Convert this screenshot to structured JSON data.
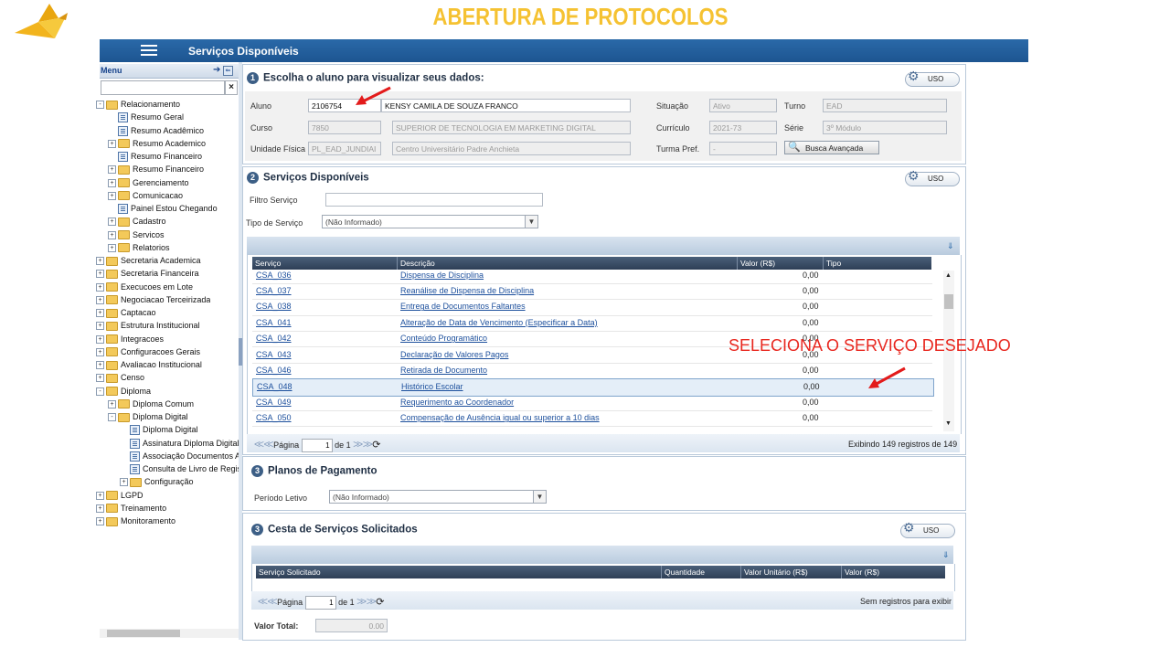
{
  "slide_title": "ABERTURA DE PROTOCOLOS",
  "app": {
    "title": "Serviços Disponíveis"
  },
  "sidebar": {
    "title": "Menu",
    "clear": "×",
    "items": [
      {
        "label": "Relacionamento",
        "level": 0,
        "type": "folder",
        "exp": "-"
      },
      {
        "label": "Resumo Geral",
        "level": 1,
        "type": "doc"
      },
      {
        "label": "Resumo Acadêmico",
        "level": 1,
        "type": "doc"
      },
      {
        "label": "Resumo Academico",
        "level": 1,
        "type": "folder",
        "exp": "+"
      },
      {
        "label": "Resumo Financeiro",
        "level": 1,
        "type": "doc"
      },
      {
        "label": "Resumo Financeiro",
        "level": 1,
        "type": "folder",
        "exp": "+"
      },
      {
        "label": "Gerenciamento",
        "level": 1,
        "type": "folder",
        "exp": "+"
      },
      {
        "label": "Comunicacao",
        "level": 1,
        "type": "folder",
        "exp": "+"
      },
      {
        "label": "Painel Estou Chegando",
        "level": 1,
        "type": "doc"
      },
      {
        "label": "Cadastro",
        "level": 1,
        "type": "folder",
        "exp": "+"
      },
      {
        "label": "Servicos",
        "level": 1,
        "type": "folder",
        "exp": "+"
      },
      {
        "label": "Relatorios",
        "level": 1,
        "type": "folder",
        "exp": "+"
      },
      {
        "label": "Secretaria Academica",
        "level": 0,
        "type": "folder",
        "exp": "+"
      },
      {
        "label": "Secretaria Financeira",
        "level": 0,
        "type": "folder",
        "exp": "+"
      },
      {
        "label": "Execucoes em Lote",
        "level": 0,
        "type": "folder",
        "exp": "+"
      },
      {
        "label": "Negociacao Terceirizada",
        "level": 0,
        "type": "folder",
        "exp": "+"
      },
      {
        "label": "Captacao",
        "level": 0,
        "type": "folder",
        "exp": "+"
      },
      {
        "label": "Estrutura Institucional",
        "level": 0,
        "type": "folder",
        "exp": "+"
      },
      {
        "label": "Integracoes",
        "level": 0,
        "type": "folder",
        "exp": "+"
      },
      {
        "label": "Configuracoes Gerais",
        "level": 0,
        "type": "folder",
        "exp": "+"
      },
      {
        "label": "Avaliacao Institucional",
        "level": 0,
        "type": "folder",
        "exp": "+"
      },
      {
        "label": "Censo",
        "level": 0,
        "type": "folder",
        "exp": "+"
      },
      {
        "label": "Diploma",
        "level": 0,
        "type": "folder",
        "exp": "-"
      },
      {
        "label": "Diploma Comum",
        "level": 1,
        "type": "folder",
        "exp": "+"
      },
      {
        "label": "Diploma Digital",
        "level": 1,
        "type": "folder",
        "exp": "-"
      },
      {
        "label": "Diploma Digital",
        "level": 2,
        "type": "doc"
      },
      {
        "label": "Assinatura Diploma Digital",
        "level": 2,
        "type": "doc"
      },
      {
        "label": "Associação Documentos Al",
        "level": 2,
        "type": "doc"
      },
      {
        "label": "Consulta de Livro de Regist",
        "level": 2,
        "type": "doc"
      },
      {
        "label": "Configuração",
        "level": 2,
        "type": "folder",
        "exp": "+"
      },
      {
        "label": "LGPD",
        "level": 0,
        "type": "folder",
        "exp": "+"
      },
      {
        "label": "Treinamento",
        "level": 0,
        "type": "folder",
        "exp": "+"
      },
      {
        "label": "Monitoramento",
        "level": 0,
        "type": "folder",
        "exp": "+"
      }
    ]
  },
  "section1": {
    "num": "1",
    "title": "Escolha o aluno para visualizar seus dados:",
    "uso": "USO",
    "labels": {
      "aluno": "Aluno",
      "curso": "Curso",
      "unidade": "Unidade Física",
      "situacao": "Situação",
      "curriculo": "Currículo",
      "turma": "Turma Pref.",
      "turno": "Turno",
      "serie": "Série"
    },
    "values": {
      "aluno_code": "2106754",
      "aluno_name": "KENSY CAMILA DE SOUZA FRANCO",
      "curso_code": "7850",
      "curso_name": "SUPERIOR DE TECNOLOGIA EM MARKETING DIGITAL",
      "unidade_code": "PL_EAD_JUNDIAI",
      "unidade_name": "Centro Universitário Padre Anchieta",
      "situacao": "Ativo",
      "curriculo": "2021-73",
      "turma": "-",
      "turno": "EAD",
      "serie": "3º Módulo"
    },
    "busca": "Busca Avançada"
  },
  "section2": {
    "num": "2",
    "title": "Serviços Disponíveis",
    "uso": "USO",
    "filtro_label": "Filtro Serviço",
    "filtro_value": "",
    "tipo_label": "Tipo de Serviço",
    "tipo_value": "(Não Informado)",
    "columns": [
      "Serviço",
      "Descrição",
      "Valor (R$)",
      "Tipo"
    ],
    "rows": [
      {
        "code": "CSA_036",
        "desc": "Dispensa de Disciplina",
        "valor": "0,00"
      },
      {
        "code": "CSA_037",
        "desc": "Reanálise de Dispensa de Disciplina",
        "valor": "0,00"
      },
      {
        "code": "CSA_038",
        "desc": "Entrega de Documentos Faltantes",
        "valor": "0,00"
      },
      {
        "code": "CSA_041",
        "desc": "Alteração de Data de Vencimento (Especificar a Data)",
        "valor": "0,00"
      },
      {
        "code": "CSA_042",
        "desc": "Conteúdo Programático",
        "valor": "0,00"
      },
      {
        "code": "CSA_043",
        "desc": "Declaração de Valores Pagos",
        "valor": "0,00"
      },
      {
        "code": "CSA_046",
        "desc": "Retirada de Documento",
        "valor": "0,00"
      },
      {
        "code": "CSA_048",
        "desc": "Histórico Escolar",
        "valor": "0,00",
        "selected": true
      },
      {
        "code": "CSA_049",
        "desc": "Requerimento ao Coordenador",
        "valor": "0,00"
      },
      {
        "code": "CSA_050",
        "desc": "Compensação de Ausência igual ou superior a 10 dias",
        "valor": "0,00"
      }
    ],
    "pager": {
      "page_label": "Página",
      "page": "1",
      "of": "de 1"
    },
    "summary": "Exibindo 149 registros de 149"
  },
  "annotation": "SELECIONA O SERVIÇO DESEJADO",
  "section3": {
    "num": "3",
    "title": "Planos de Pagamento",
    "periodo_label": "Período Letivo",
    "periodo_value": "(Não Informado)"
  },
  "section4": {
    "num": "3",
    "title": "Cesta de Serviços Solicitados",
    "uso": "USO",
    "columns": [
      "Serviço Solicitado",
      "Quantidade",
      "Valor Unitário (R$)",
      "Valor (R$)"
    ],
    "pager": {
      "page_label": "Página",
      "page": "1",
      "of": "de 1"
    },
    "summary": "Sem registros para exibir",
    "total_label": "Valor Total:",
    "total_value": "0.00"
  },
  "colors": {
    "accent": "#2a69a8",
    "title": "#f5c232",
    "annotation": "#e8271f",
    "arrow": "#e31b1b"
  }
}
